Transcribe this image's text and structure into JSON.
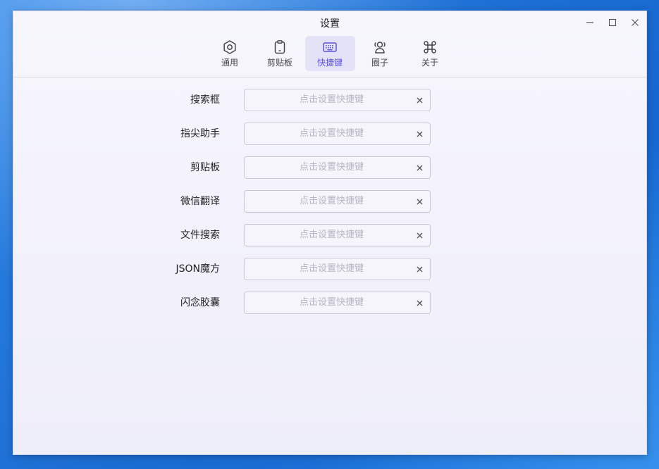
{
  "window": {
    "title": "设置",
    "controls": [
      "minimize-icon",
      "maximize-icon",
      "close-icon"
    ]
  },
  "tabs": [
    {
      "label": "通用",
      "icon": "hexagon-settings-icon",
      "active": false
    },
    {
      "label": "剪贴板",
      "icon": "clipboard-icon",
      "active": false
    },
    {
      "label": "快捷键",
      "icon": "keyboard-icon",
      "active": true
    },
    {
      "label": "圈子",
      "icon": "users-icon",
      "active": false
    },
    {
      "label": "关于",
      "icon": "command-icon",
      "active": false
    }
  ],
  "hotkeys": [
    {
      "label": "搜索框",
      "placeholder": "点击设置快捷键"
    },
    {
      "label": "指尖助手",
      "placeholder": "点击设置快捷键"
    },
    {
      "label": "剪贴板",
      "placeholder": "点击设置快捷键"
    },
    {
      "label": "微信翻译",
      "placeholder": "点击设置快捷键"
    },
    {
      "label": "文件搜索",
      "placeholder": "点击设置快捷键"
    },
    {
      "label": "JSON魔方",
      "placeholder": "点击设置快捷键"
    },
    {
      "label": "闪念胶囊",
      "placeholder": "点击设置快捷键"
    }
  ],
  "colors": {
    "accent": "#5b52d6",
    "active_tab_bg": "#e3e2f7",
    "placeholder": "#b6b5c2"
  }
}
